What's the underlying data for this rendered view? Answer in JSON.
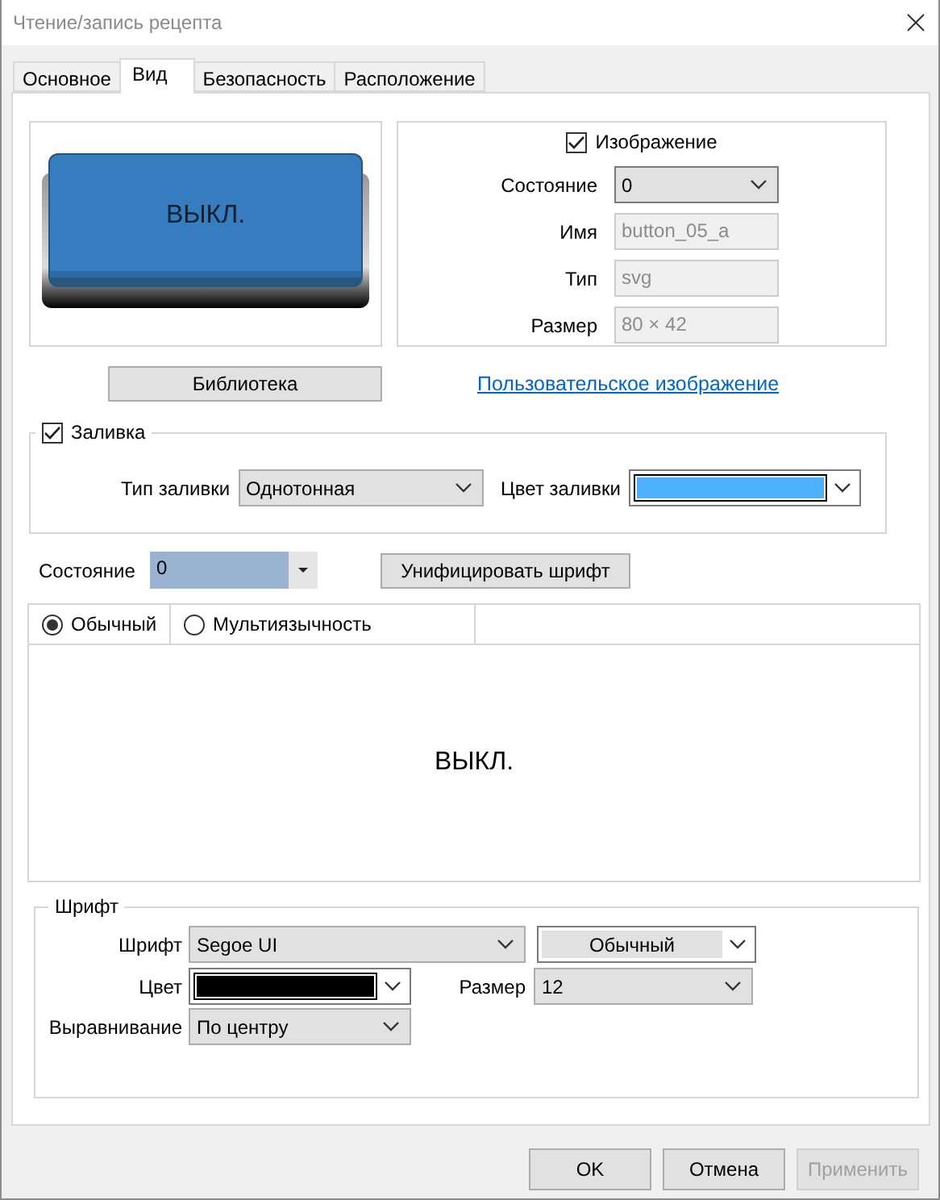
{
  "window": {
    "title": "Чтение/запись рецепта"
  },
  "tabs": [
    {
      "label": "Основное",
      "selected": false
    },
    {
      "label": "Вид",
      "selected": true
    },
    {
      "label": "Безопасность",
      "selected": false
    },
    {
      "label": "Расположение",
      "selected": false
    }
  ],
  "image": {
    "preview_text": "ВЫКЛ.",
    "label": "Изображение",
    "checked": true,
    "fields": [
      {
        "label": "Состояние",
        "value": "0",
        "kind": "dropdown"
      },
      {
        "label": "Имя",
        "value": "button_05_a",
        "kind": "readonly"
      },
      {
        "label": "Тип",
        "value": "svg",
        "kind": "readonly"
      },
      {
        "label": "Размер",
        "value": "80 × 42",
        "kind": "readonly"
      }
    ]
  },
  "library_button": "Библиотека",
  "custom_image_link": "Пользовательское изображение",
  "fill": {
    "label": "Заливка",
    "checked": true,
    "type_label": "Тип заливки",
    "type_value": "Однотонная",
    "color_label": "Цвет заливки",
    "color": "#4db1fe"
  },
  "state": {
    "label": "Состояние",
    "value": "0"
  },
  "unify_button": "Унифицировать шрифт",
  "text_modes": [
    {
      "label": "Обычный",
      "selected": true
    },
    {
      "label": "Мультиязычность",
      "selected": false
    }
  ],
  "text_preview": "ВЫКЛ.",
  "font": {
    "title": "Шрифт",
    "family_label": "Шрифт",
    "family": "Segoe UI",
    "style": "Обычный",
    "color_label": "Цвет",
    "color": "#000000",
    "size_label": "Размер",
    "size": "12",
    "align_label": "Выравнивание",
    "align": "По центру"
  },
  "buttons": [
    {
      "label": "OK",
      "disabled": false
    },
    {
      "label": "Отмена",
      "disabled": false
    },
    {
      "label": "Применить",
      "disabled": true
    }
  ]
}
